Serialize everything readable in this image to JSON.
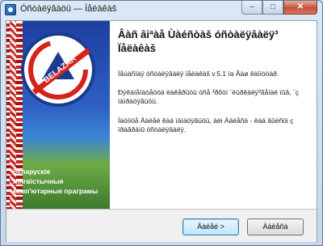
{
  "window": {
    "title": "Óñòàëÿâàöü — Ïåëàêàš",
    "min_glyph": "–",
    "max_glyph": "□",
    "close_glyph": "✕"
  },
  "sidebar": {
    "logo_text": "BELAZAR",
    "tagline": [
      "беларускія",
      "лінгвістычныя",
      "камп'ютарныя праграмы"
    ]
  },
  "content": {
    "heading": "Âàñ âiªàå Ùàéñòàš óñòàëÿâàëÿ³ Ïåëàêàš",
    "paragraph1": "Ìåùàñíàÿ óñòàëÿâàëÿ ïåëàêàš v.5.1 ïa Âàø êàìïóòàð.",
    "paragraph2": "Ðýêàìåíäóåööà ëàêåðûöü óñå ³ðõöí ¨ëüðêàëÿ³ãåíàé ïûâ, ¨ç ïàïðàöÿãüöü.",
    "paragraph3": "Ìàöíiöå Äàëåé êàá ïàìàöÿãüöü, àëi Àäëåñà - êàá âûéñöi ç ïðàãðàìû óñòàëÿâàëÿ."
  },
  "buttons": {
    "next": "Äàëåé >",
    "cancel": "Àäëåñà"
  },
  "colors": {
    "accent": "#2d5fc4",
    "ornament_red": "#c8201d",
    "logo_red": "#d6221c"
  }
}
